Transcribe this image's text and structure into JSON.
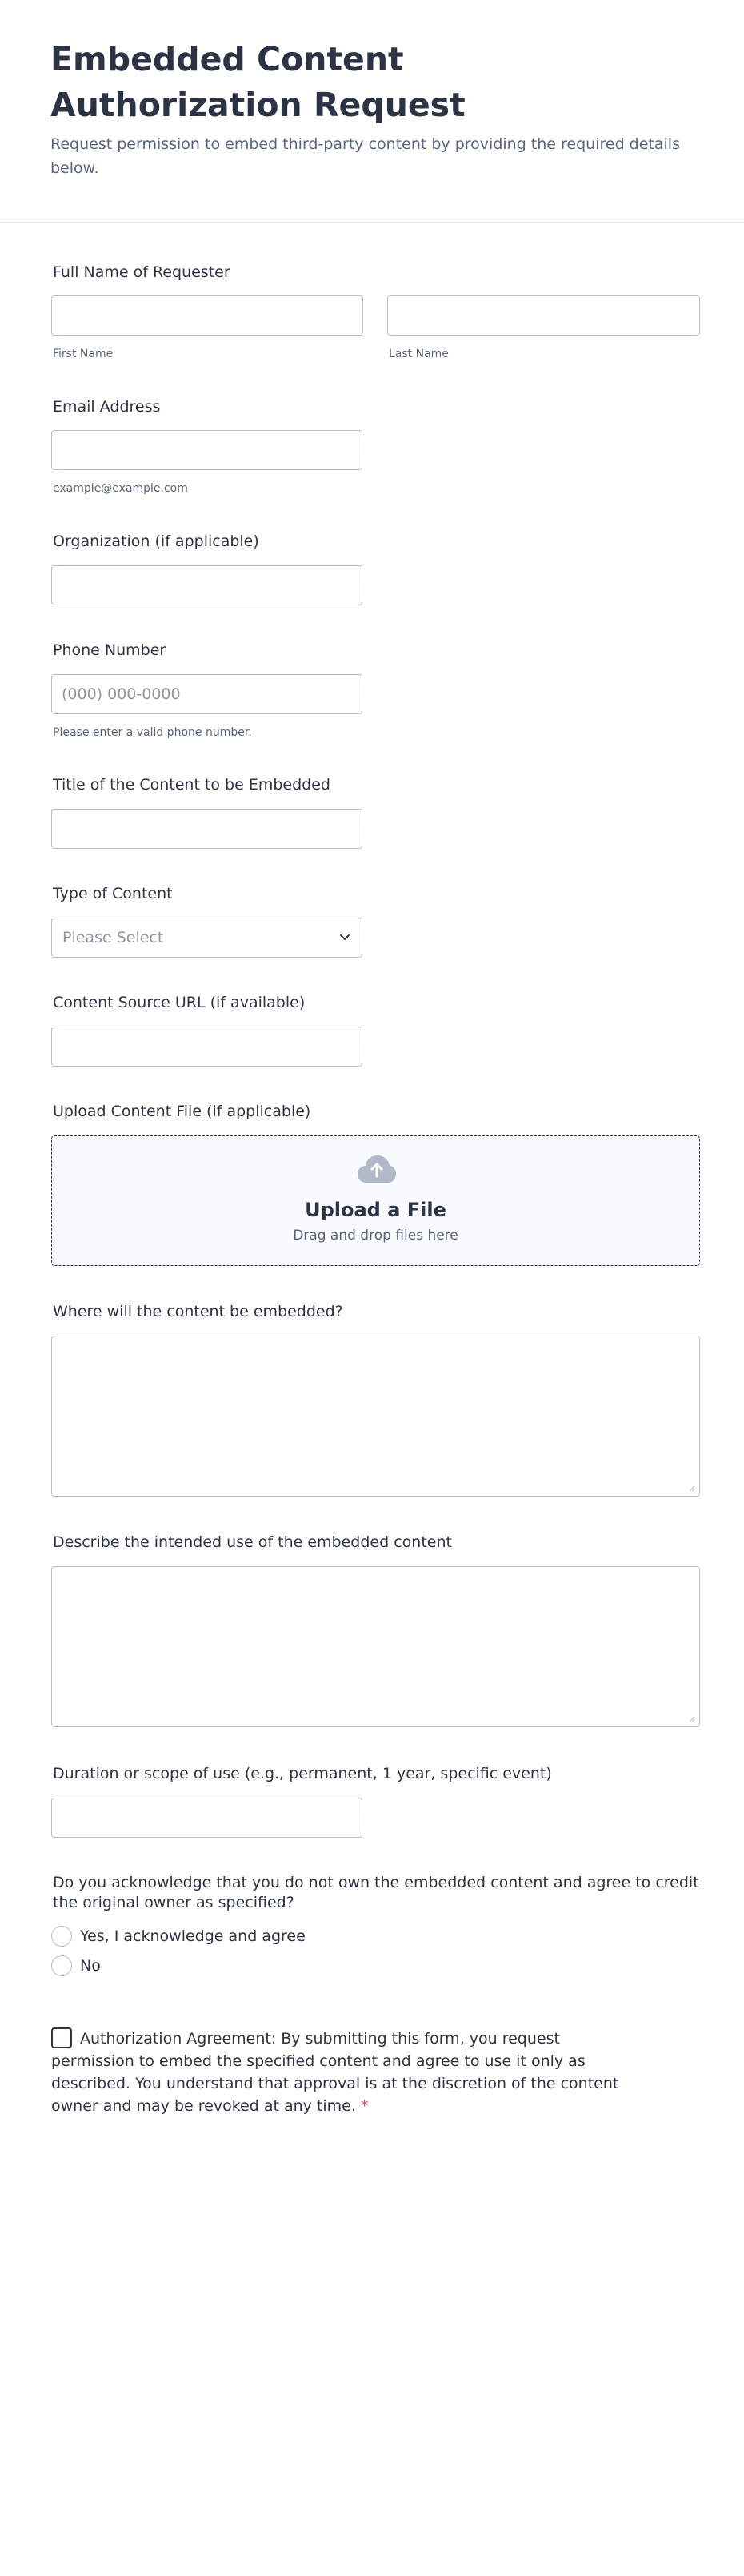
{
  "header": {
    "title": "Embedded Content Authorization Request",
    "subtitle": "Request permission to embed third-party content by providing the required details below."
  },
  "fields": {
    "full_name": {
      "label": "Full Name of Requester",
      "first_sublabel": "First Name",
      "last_sublabel": "Last Name",
      "first_value": "",
      "last_value": ""
    },
    "email": {
      "label": "Email Address",
      "sublabel": "example@example.com",
      "value": ""
    },
    "organization": {
      "label": "Organization (if applicable)",
      "value": ""
    },
    "phone": {
      "label": "Phone Number",
      "placeholder": "(000) 000-0000",
      "sublabel": "Please enter a valid phone number.",
      "value": ""
    },
    "content_title": {
      "label": "Title of the Content to be Embedded",
      "value": ""
    },
    "content_type": {
      "label": "Type of Content",
      "selected": "Please Select"
    },
    "source_url": {
      "label": "Content Source URL (if available)",
      "value": ""
    },
    "upload": {
      "label": "Upload Content File (if applicable)",
      "title": "Upload a File",
      "subtitle": "Drag and drop files here"
    },
    "embed_location": {
      "label": "Where will the content be embedded?"
    },
    "intended_use": {
      "label": "Describe the intended use of the embedded content"
    },
    "duration": {
      "label": "Duration or scope of use (e.g., permanent, 1 year, specific event)",
      "value": ""
    },
    "acknowledge": {
      "label": "Do you acknowledge that you do not own the embedded content and agree to credit the original owner as specified?",
      "options": [
        "Yes, I acknowledge and agree",
        "No"
      ]
    },
    "agreement": {
      "text": "Authorization Agreement: By submitting this form, you request permission to embed the specified content and agree to use it only as described. You understand that approval is at the discretion of the content owner and may be revoked at any time.",
      "required_mark": "*"
    }
  },
  "colors": {
    "text": "#2c3345",
    "muted": "#57647e",
    "border": "#b8bdc9",
    "required": "#f23a3c",
    "upload_bg": "#f9fafd"
  }
}
